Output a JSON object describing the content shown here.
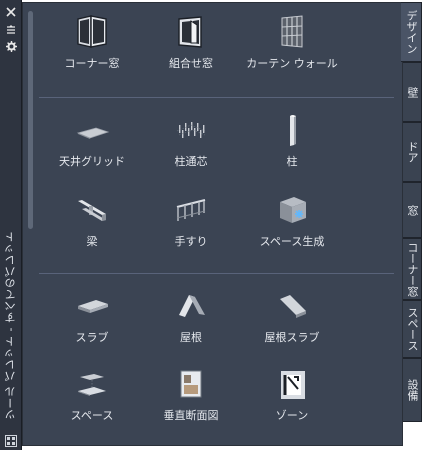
{
  "palette": {
    "title": "ツール パレット - すべてのパレット"
  },
  "sections": [
    {
      "tools": [
        {
          "label": "コーナー窓",
          "icon": "corner-window-icon"
        },
        {
          "label": "組合せ窓",
          "icon": "assembly-window-icon"
        },
        {
          "label": "カーテン ウォール",
          "icon": "curtain-wall-icon"
        }
      ]
    },
    {
      "tools": [
        {
          "label": "天井グリッド",
          "icon": "ceiling-grid-icon"
        },
        {
          "label": "柱通芯",
          "icon": "column-grid-icon"
        },
        {
          "label": "柱",
          "icon": "column-icon"
        },
        {
          "label": "梁",
          "icon": "beam-icon"
        },
        {
          "label": "手すり",
          "icon": "railing-icon"
        },
        {
          "label": "スペース生成",
          "icon": "space-generate-icon"
        }
      ]
    },
    {
      "tools": [
        {
          "label": "スラブ",
          "icon": "slab-icon"
        },
        {
          "label": "屋根",
          "icon": "roof-icon"
        },
        {
          "label": "屋根スラブ",
          "icon": "roof-slab-icon"
        },
        {
          "label": "スペース",
          "icon": "space-icon"
        },
        {
          "label": "垂直断面図",
          "icon": "vertical-section-icon"
        },
        {
          "label": "ゾーン",
          "icon": "zone-icon"
        }
      ]
    }
  ],
  "tabs": [
    {
      "label": "デザイン",
      "active": true
    },
    {
      "label": "壁"
    },
    {
      "label": "ドア"
    },
    {
      "label": "窓"
    },
    {
      "label": "コーナー窓"
    },
    {
      "label": "スペース"
    },
    {
      "label": "設備"
    }
  ],
  "colors": {
    "panel": "#3b4453",
    "strip": "#2e3440",
    "text": "#e6e9ee"
  }
}
